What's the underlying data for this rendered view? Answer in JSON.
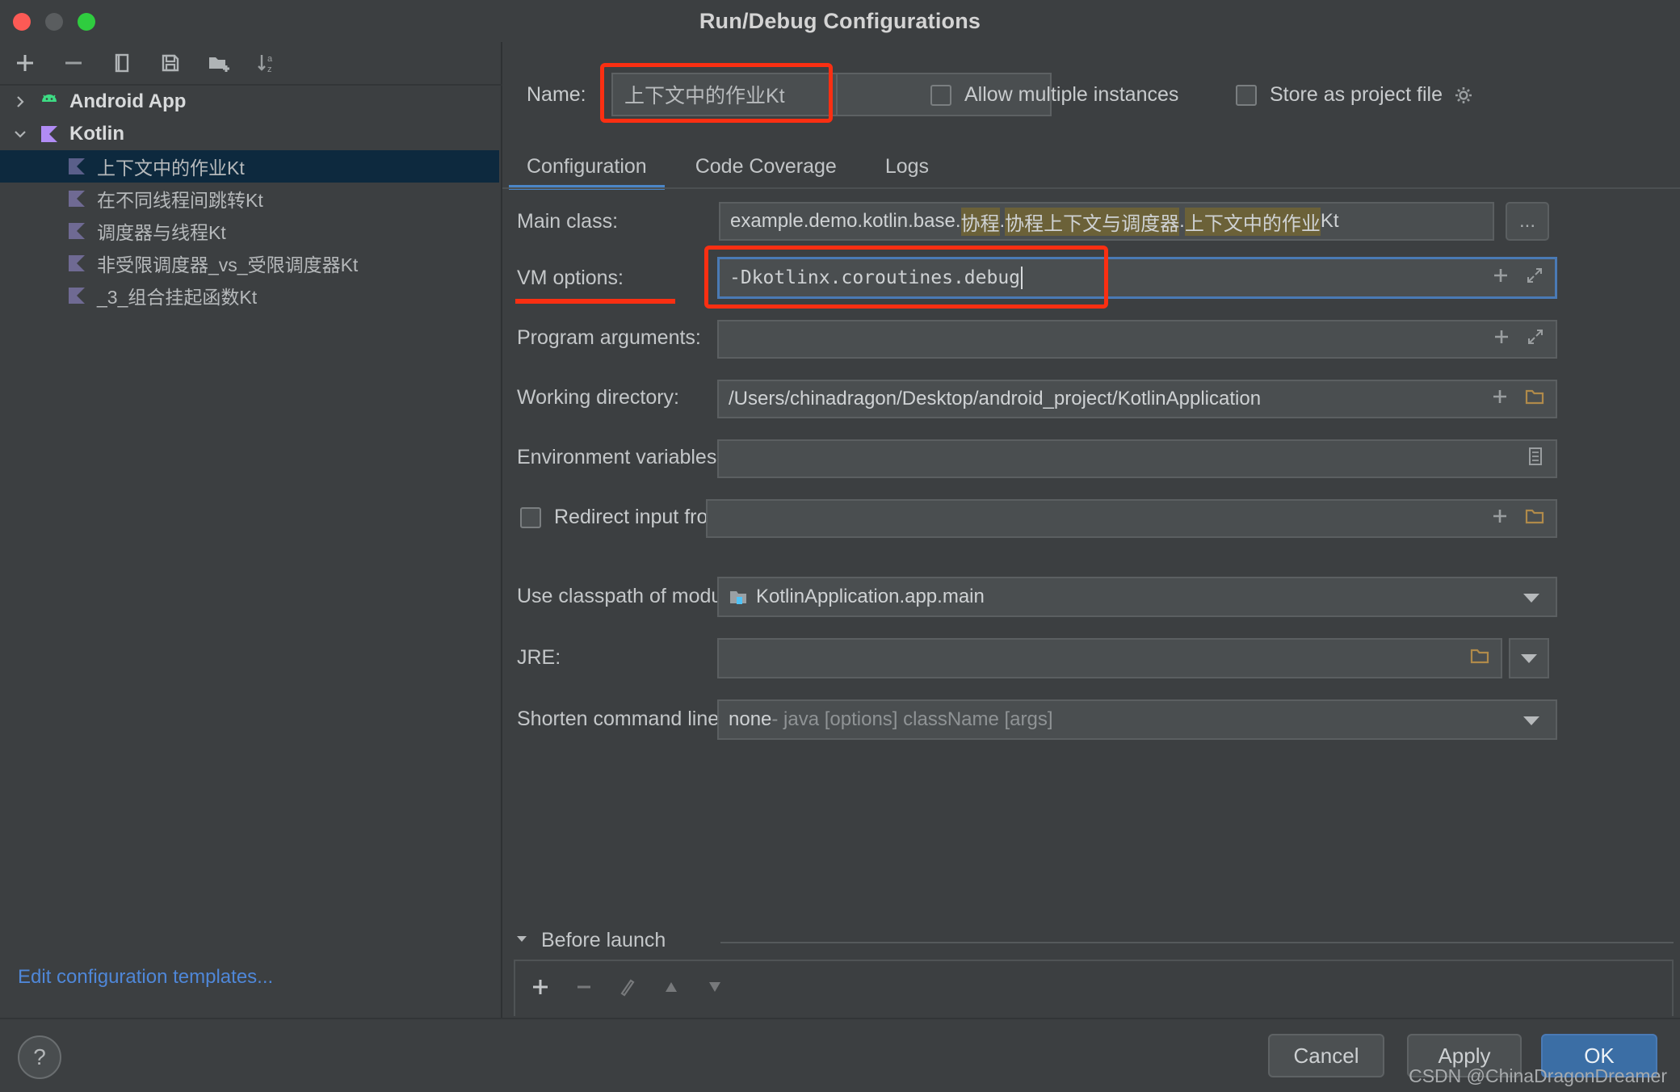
{
  "window": {
    "title": "Run/Debug Configurations",
    "traffic_lights": [
      "close",
      "minimize",
      "zoom"
    ]
  },
  "left_panel": {
    "toolbar": [
      {
        "name": "add-configuration-button",
        "glyph": "plus"
      },
      {
        "name": "remove-configuration-button",
        "glyph": "minus"
      },
      {
        "name": "copy-configuration-button",
        "glyph": "copy"
      },
      {
        "name": "save-configuration-button",
        "glyph": "save"
      },
      {
        "name": "new-folder-button",
        "glyph": "folder-plus"
      },
      {
        "name": "sort-alphabetically-button",
        "glyph": "sort-az"
      }
    ],
    "tree": [
      {
        "label": "Android App",
        "level": 0,
        "expanded": false,
        "icon": "android-icon",
        "selected": false
      },
      {
        "label": "Kotlin",
        "level": 0,
        "expanded": true,
        "icon": "kotlin-icon",
        "selected": false
      },
      {
        "label": "上下文中的作业Kt",
        "level": 1,
        "icon": "kotlin-file-icon",
        "selected": true
      },
      {
        "label": "在不同线程间跳转Kt",
        "level": 1,
        "icon": "kotlin-file-icon",
        "selected": false
      },
      {
        "label": "调度器与线程Kt",
        "level": 1,
        "icon": "kotlin-file-icon",
        "selected": false
      },
      {
        "label": "非受限调度器_vs_受限调度器Kt",
        "level": 1,
        "icon": "kotlin-file-icon",
        "selected": false
      },
      {
        "label": "_3_组合挂起函数Kt",
        "level": 1,
        "icon": "kotlin-file-icon",
        "selected": false
      }
    ],
    "edit_templates_link": "Edit configuration templates..."
  },
  "header": {
    "name_label": "Name:",
    "name_value": "上下文中的作业Kt",
    "allow_multiple_instances": {
      "label": "Allow multiple instances",
      "checked": false
    },
    "store_as_project_file": {
      "label": "Store as project file",
      "checked": false,
      "gear_icon": "gear-icon"
    }
  },
  "tabs": [
    {
      "label": "Configuration",
      "active": true
    },
    {
      "label": "Code Coverage",
      "active": false
    },
    {
      "label": "Logs",
      "active": false
    }
  ],
  "form": {
    "main_class": {
      "label": "Main class:",
      "prefix": "example.demo.kotlin.base.",
      "segments": [
        {
          "text": "协程",
          "highlighted": true
        },
        {
          "text": ".",
          "highlighted": false
        },
        {
          "text": "协程上下文与调度器",
          "highlighted": true
        },
        {
          "text": ".",
          "highlighted": false
        },
        {
          "text": "上下文中的作业",
          "highlighted": true
        },
        {
          "text": "Kt",
          "highlighted": false
        }
      ],
      "browse_button": "..."
    },
    "vm_options": {
      "label": "VM options:",
      "value": "-Dkotlinx.coroutines.debug",
      "focused": true,
      "icons": [
        "plus-icon",
        "expand-icon"
      ]
    },
    "program_arguments": {
      "label": "Program arguments:",
      "value": "",
      "icons": [
        "plus-icon",
        "expand-icon"
      ]
    },
    "working_directory": {
      "label": "Working directory:",
      "value": "/Users/chinadragon/Desktop/android_project/KotlinApplication",
      "icons": [
        "plus-icon",
        "folder-icon"
      ]
    },
    "environment_variables": {
      "label": "Environment variables:",
      "value": "",
      "icons": [
        "list-icon"
      ]
    },
    "redirect_input_from": {
      "label": "Redirect input from:",
      "checked": false,
      "value": "",
      "icons": [
        "plus-icon",
        "folder-icon"
      ]
    },
    "use_classpath_of_module": {
      "label": "Use classpath of module:",
      "value": "KotlinApplication.app.main",
      "icon": "module-icon"
    },
    "jre": {
      "label": "JRE:",
      "value": "",
      "icons": [
        "folder-icon"
      ]
    },
    "shorten_command_line": {
      "label": "Shorten command line:",
      "value": "none",
      "hint": " - java [options] className [args]"
    }
  },
  "before_launch": {
    "title": "Before launch",
    "expanded": true,
    "toolbar": [
      "add-task-button",
      "remove-task-button",
      "edit-task-button",
      "move-up-button",
      "move-down-button"
    ]
  },
  "footer": {
    "help_button": "?",
    "cancel": "Cancel",
    "apply": "Apply",
    "ok": "OK",
    "watermark": "CSDN @ChinaDragonDreamer"
  },
  "colors": {
    "accent_blue": "#4b86c7",
    "highlight_red": "#fa2f12",
    "selection_blue": "#0d293e",
    "link_blue": "#4f87d8",
    "match_highlight": "#6b6138"
  }
}
